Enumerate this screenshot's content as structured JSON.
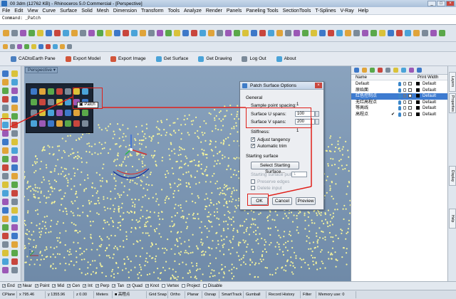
{
  "window": {
    "title": "00 3dm (12762 KB) - Rhinoceros 5.0 Commercial - [Perspective]"
  },
  "menu": [
    "File",
    "Edit",
    "View",
    "Curve",
    "Surface",
    "Solid",
    "Mesh",
    "Dimension",
    "Transform",
    "Tools",
    "Analyze",
    "Render",
    "Panels",
    "Paneling Tools",
    "SectionTools",
    "T-Splines",
    "V-Ray",
    "Help"
  ],
  "command": {
    "prompt": "Command: _Patch"
  },
  "plugin_toolbar": [
    "CADtoEarth Pane",
    "Export Model",
    "Export Image",
    "Get Surface",
    "Get Drawing",
    "Log Out",
    "About"
  ],
  "viewport": {
    "label": "Perspective"
  },
  "tooltip": {
    "text": "Patch"
  },
  "dialog": {
    "title": "Patch Surface Options",
    "general_label": "General",
    "sample_spacing_label": "Sample point spacing:",
    "sample_spacing_value": "1",
    "u_spans_label": "Surface U spans:",
    "u_spans_value": "100",
    "v_spans_label": "Surface V spans:",
    "v_spans_value": "200",
    "stiffness_label": "Stiffness:",
    "stiffness_value": "1",
    "adjust_tangency_label": "Adjust tangency",
    "automatic_trim_label": "Automatic trim",
    "starting_surface_label": "Starting surface",
    "select_starting_surface_label": "Select Starting Surface...",
    "starting_surface_pull_label": "Starting surface pull:",
    "starting_surface_pull_value": "1",
    "preserve_edges_label": "Preserve edges",
    "delete_input_label": "Delete input",
    "ok_label": "OK",
    "cancel_label": "Cancel",
    "preview_label": "Preview"
  },
  "layers": {
    "header_name": "Name",
    "header_print_width": "Print Width",
    "rows": [
      {
        "name": "Default",
        "print_width": "Default",
        "selected": false,
        "current": false
      },
      {
        "name": "原始面",
        "print_width": "Default",
        "selected": false,
        "current": false
      },
      {
        "name": "红色控制点",
        "print_width": "Default",
        "selected": true,
        "current": false
      },
      {
        "name": "无红高程点",
        "print_width": "Default",
        "selected": false,
        "current": false
      },
      {
        "name": "等高线",
        "print_width": "Default",
        "selected": false,
        "current": false
      },
      {
        "name": "高程点",
        "print_width": "Default",
        "selected": false,
        "current": true
      }
    ]
  },
  "side_tabs": [
    "Layers",
    "Properties",
    "Display",
    "Help"
  ],
  "osnap": [
    "End",
    "Near",
    "Point",
    "Mid",
    "Cen",
    "Int",
    "Perp",
    "Tan",
    "Quad",
    "Knot",
    "Vertex",
    "Project",
    "Disable"
  ],
  "status": [
    "CPlane",
    "x 795.46",
    "y 1355.96",
    "z 0.00",
    "Meters",
    "■ 高程点",
    "Grid Snap",
    "Ortho",
    "Planar",
    "Osnap",
    "SmartTrack",
    "Gumball",
    "Record History",
    "Filter",
    "Memory use: 0"
  ],
  "colors": {
    "annotation": "#e0201a",
    "selection": "#3d7bd0",
    "point_cloud": "#f4f39a",
    "viewport_bg": "#7d97b4"
  }
}
